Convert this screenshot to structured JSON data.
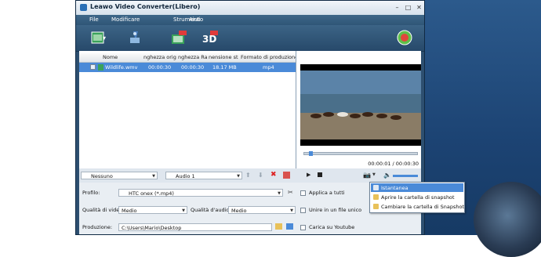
{
  "window": {
    "title": "Leawo Video Converter(Libero)"
  },
  "menu": {
    "items": [
      "File",
      "Modificare",
      "Strumenti",
      "Aiuto"
    ]
  },
  "file_table": {
    "headers": [
      "Nome",
      "nghezza origin",
      "nghezza Rasa",
      "nensione stim",
      "Formato di produzione"
    ],
    "rows": [
      {
        "name": "Wildlife.wmv",
        "orig_len": "00:00:30",
        "trim_len": "00:00:30",
        "size": "18.17 MB",
        "format": "mp4"
      }
    ]
  },
  "player": {
    "time": "00:00:01 / 00:00:30"
  },
  "list_controls": {
    "subtitle": "Nessuno",
    "audio": "Audio 1"
  },
  "settings": {
    "profile_label": "Profilo:",
    "profile_value": "HTC onex (*.mp4)",
    "apply_all": "Applica a tutti",
    "video_quality_label": "Qualità di video:",
    "video_quality_value": "Medio",
    "audio_quality_label": "Qualità d'audio:",
    "audio_quality_value": "Medio",
    "merge_label": "Unire in un file unico",
    "output_label": "Produzione:",
    "output_path": "C:\\Users\\Mario\\Desktop",
    "upload_label": "Carica su Youtube"
  },
  "snapshot_menu": {
    "items": [
      "Istantanea",
      "Aprire la cartella di snapshot",
      "Cambiare la cartella di Snapshot"
    ]
  },
  "colors": {
    "accent": "#4a8ad8",
    "toolbar": "#2d4f70",
    "desktop": "#1c4373"
  }
}
